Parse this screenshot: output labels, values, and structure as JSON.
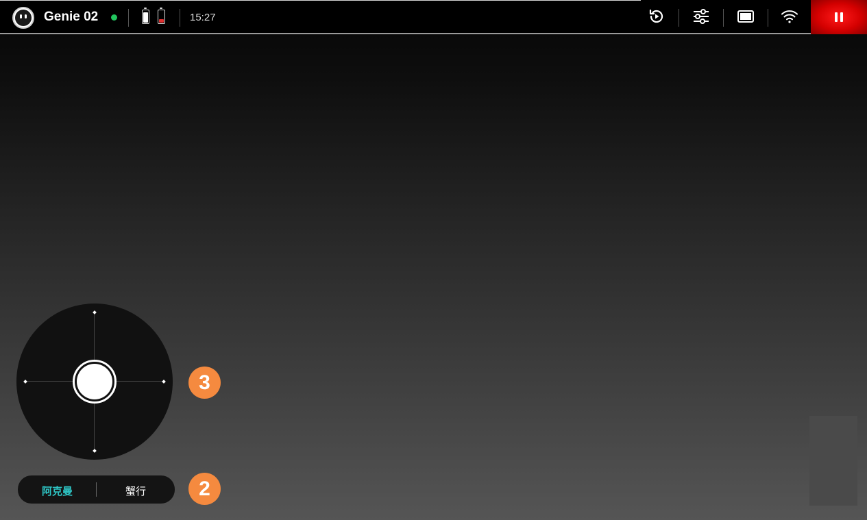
{
  "header": {
    "robot_name": "Genie 02",
    "connection_status_color": "#22c55e",
    "battery_left": {
      "level": 0.8,
      "color": "#ffffff"
    },
    "battery_right": {
      "level": 0.25,
      "color": "#e03030"
    },
    "time": "15:27",
    "icons": [
      "replay-icon",
      "settings-sliders-icon",
      "screen-icon",
      "wifi-icon",
      "pause-icon"
    ],
    "pause_color": "#e00000"
  },
  "joystick": {
    "badge": "3"
  },
  "mode_switch": {
    "options": [
      "阿克曼",
      "蟹行"
    ],
    "selected": "阿克曼",
    "accent_color": "#2ec4c4",
    "badge": "2"
  }
}
